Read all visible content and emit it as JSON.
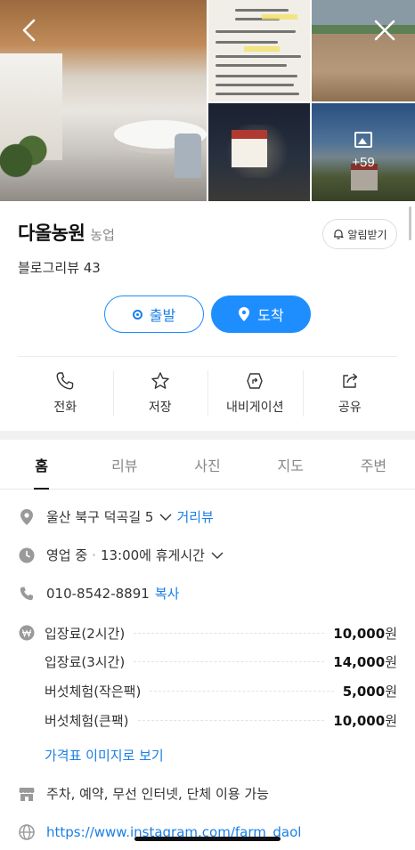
{
  "place": {
    "name": "다올농원",
    "category": "농업",
    "reviews": "블로그리뷰 43",
    "notify_label": "알림받기"
  },
  "gallery": {
    "more_count": "+59"
  },
  "route": {
    "depart_label": "출발",
    "arrive_label": "도착"
  },
  "actions": [
    {
      "label": "전화",
      "icon": "phone-icon"
    },
    {
      "label": "저장",
      "icon": "star-icon"
    },
    {
      "label": "내비게이션",
      "icon": "navigation-icon"
    },
    {
      "label": "공유",
      "icon": "share-icon"
    }
  ],
  "tabs": [
    {
      "label": "홈",
      "active": true
    },
    {
      "label": "리뷰"
    },
    {
      "label": "사진"
    },
    {
      "label": "지도"
    },
    {
      "label": "주변"
    }
  ],
  "info": {
    "address": "울산 북구 덕곡길 5",
    "street_view_label": "거리뷰",
    "hours_status": "영업 중",
    "hours_sep": "·",
    "hours_detail": "13:00에 휴게시간",
    "phone": "010-8542-8891",
    "copy_label": "복사",
    "prices": [
      {
        "item": "입장료(2시간)",
        "amount": "10,000",
        "unit": "원"
      },
      {
        "item": "입장료(3시간)",
        "amount": "14,000",
        "unit": "원"
      },
      {
        "item": "버섯체험(작은팩)",
        "amount": "5,000",
        "unit": "원"
      },
      {
        "item": "버섯체험(큰팩)",
        "amount": "10,000",
        "unit": "원"
      }
    ],
    "price_image_link": "가격표 이미지로 보기",
    "amenities": "주차, 예약, 무선 인터넷, 단체 이용 가능",
    "website": "https://www.instagram.com/farm_daol"
  },
  "colors": {
    "accent": "#1e8eff",
    "link": "#1a7fe6"
  }
}
